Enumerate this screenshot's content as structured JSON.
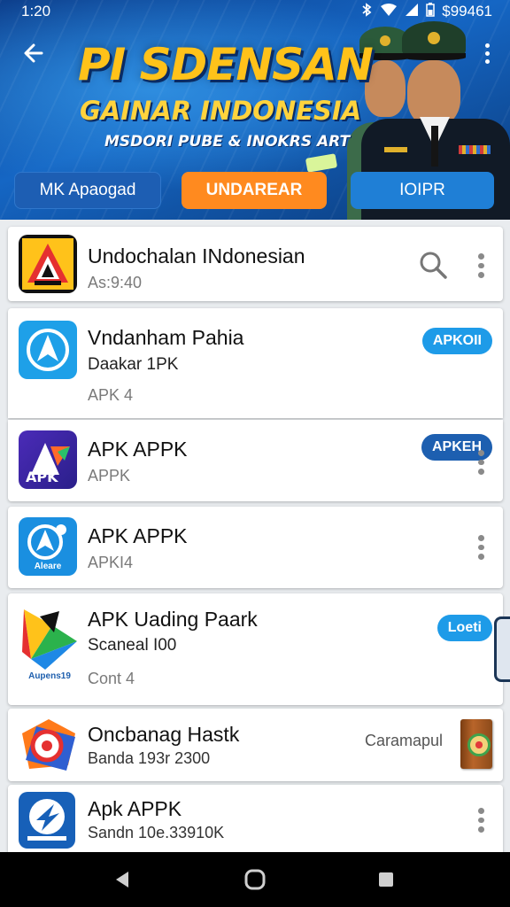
{
  "status_bar": {
    "time": "1:20",
    "right_text": "$99461",
    "icons": [
      "bluetooth-icon",
      "wifi-icon",
      "signal-icon",
      "battery-icon"
    ]
  },
  "header": {
    "title": "PI SDENSAN",
    "subtitle": "GAINAR INDONESIA",
    "tagline": "MSDORI PUBE & INOKRS ART",
    "tabs": [
      {
        "label": "MK Apaogad"
      },
      {
        "label": "UNDAREAR"
      },
      {
        "label": "IOIPR"
      }
    ]
  },
  "apps": [
    {
      "title": "Undochalan INdonesian",
      "meta": "As:9:40"
    },
    {
      "title": "Vndanham Pahia",
      "line2": "Daakar 1PK",
      "meta": "APK 4",
      "button": "APKOII"
    },
    {
      "title": "APK APPK",
      "meta": "APPK",
      "button": "APKEH"
    },
    {
      "title": "APK APPK",
      "meta": "APKI4",
      "icon_caption": "Aleare"
    },
    {
      "title": "APK Uading Paark",
      "line2": "Scaneal I00",
      "meta": "Cont 4",
      "button": "Loeti",
      "icon_caption": "Aupens19"
    },
    {
      "title": "Oncbanag Hastk",
      "meta": "Banda 193r 2300",
      "side_text": "Caramapul"
    },
    {
      "title": "Apk APPK",
      "meta": "Sandn 10e.33910K"
    }
  ],
  "colors": {
    "banner_dark": "#0d3f8c",
    "banner_mid": "#1566c4",
    "tab_orange": "#ff8a1f",
    "pill_light": "#1e9be8",
    "pill_dark": "#1d5fb0",
    "title_yellow": "#ffc21a"
  }
}
